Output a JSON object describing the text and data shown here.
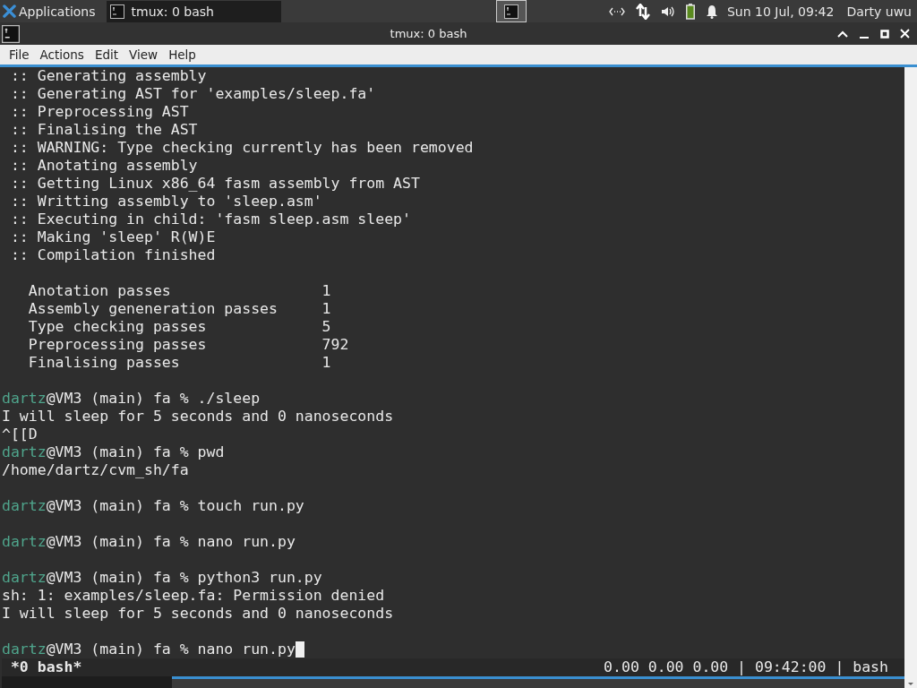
{
  "top_panel": {
    "applications": "Applications",
    "tasks": [
      {
        "label": "tmux: 0 bash",
        "selected": true
      }
    ],
    "clock": "Sun 10 Jul, 09:42",
    "user": "Darty uwu"
  },
  "window": {
    "title": "tmux: 0 bash"
  },
  "menu": [
    "File",
    "Actions",
    "Edit",
    "View",
    "Help"
  ],
  "terminal": {
    "lines": [
      {
        "kind": "text",
        "text": " :: Generating assembly"
      },
      {
        "kind": "text",
        "text": " :: Generating AST for 'examples/sleep.fa'"
      },
      {
        "kind": "text",
        "text": " :: Preprocessing AST"
      },
      {
        "kind": "text",
        "text": " :: Finalising the AST"
      },
      {
        "kind": "text",
        "text": " :: WARNING: Type checking currently has been removed"
      },
      {
        "kind": "text",
        "text": " :: Anotating assembly"
      },
      {
        "kind": "text",
        "text": " :: Getting Linux x86_64 fasm assembly from AST"
      },
      {
        "kind": "text",
        "text": " :: Writting assembly to 'sleep.asm'"
      },
      {
        "kind": "text",
        "text": " :: Executing in child: 'fasm sleep.asm sleep'"
      },
      {
        "kind": "text",
        "text": " :: Making 'sleep' R(W)E"
      },
      {
        "kind": "text",
        "text": " :: Compilation finished"
      },
      {
        "kind": "blank"
      },
      {
        "kind": "text",
        "text": "   Anotation passes                 1"
      },
      {
        "kind": "text",
        "text": "   Assembly geneneration passes     1"
      },
      {
        "kind": "text",
        "text": "   Type checking passes             5"
      },
      {
        "kind": "text",
        "text": "   Preprocessing passes             792"
      },
      {
        "kind": "text",
        "text": "   Finalising passes                1"
      },
      {
        "kind": "blank"
      },
      {
        "kind": "prompt",
        "user": "dartz",
        "rest": "@VM3 (main) fa % ./sleep",
        "cursor": false
      },
      {
        "kind": "text",
        "text": "I will sleep for 5 seconds and 0 nanoseconds"
      },
      {
        "kind": "text",
        "text": "^[[D"
      },
      {
        "kind": "prompt",
        "user": "dartz",
        "rest": "@VM3 (main) fa % pwd",
        "cursor": false
      },
      {
        "kind": "text",
        "text": "/home/dartz/cvm_sh/fa"
      },
      {
        "kind": "blank"
      },
      {
        "kind": "prompt",
        "user": "dartz",
        "rest": "@VM3 (main) fa % touch run.py",
        "cursor": false
      },
      {
        "kind": "blank"
      },
      {
        "kind": "prompt",
        "user": "dartz",
        "rest": "@VM3 (main) fa % nano run.py",
        "cursor": false
      },
      {
        "kind": "blank"
      },
      {
        "kind": "prompt",
        "user": "dartz",
        "rest": "@VM3 (main) fa % python3 run.py",
        "cursor": false
      },
      {
        "kind": "text",
        "text": "sh: 1: examples/sleep.fa: Permission denied"
      },
      {
        "kind": "text",
        "text": "I will sleep for 5 seconds and 0 nanoseconds"
      },
      {
        "kind": "blank"
      },
      {
        "kind": "prompt",
        "user": "dartz",
        "rest": "@VM3 (main) fa % nano run.py",
        "cursor": true
      }
    ]
  },
  "tmux_status": {
    "window": " *0 bash*",
    "right": "0.00 0.00 0.00 | 09:42:00 | bash"
  }
}
